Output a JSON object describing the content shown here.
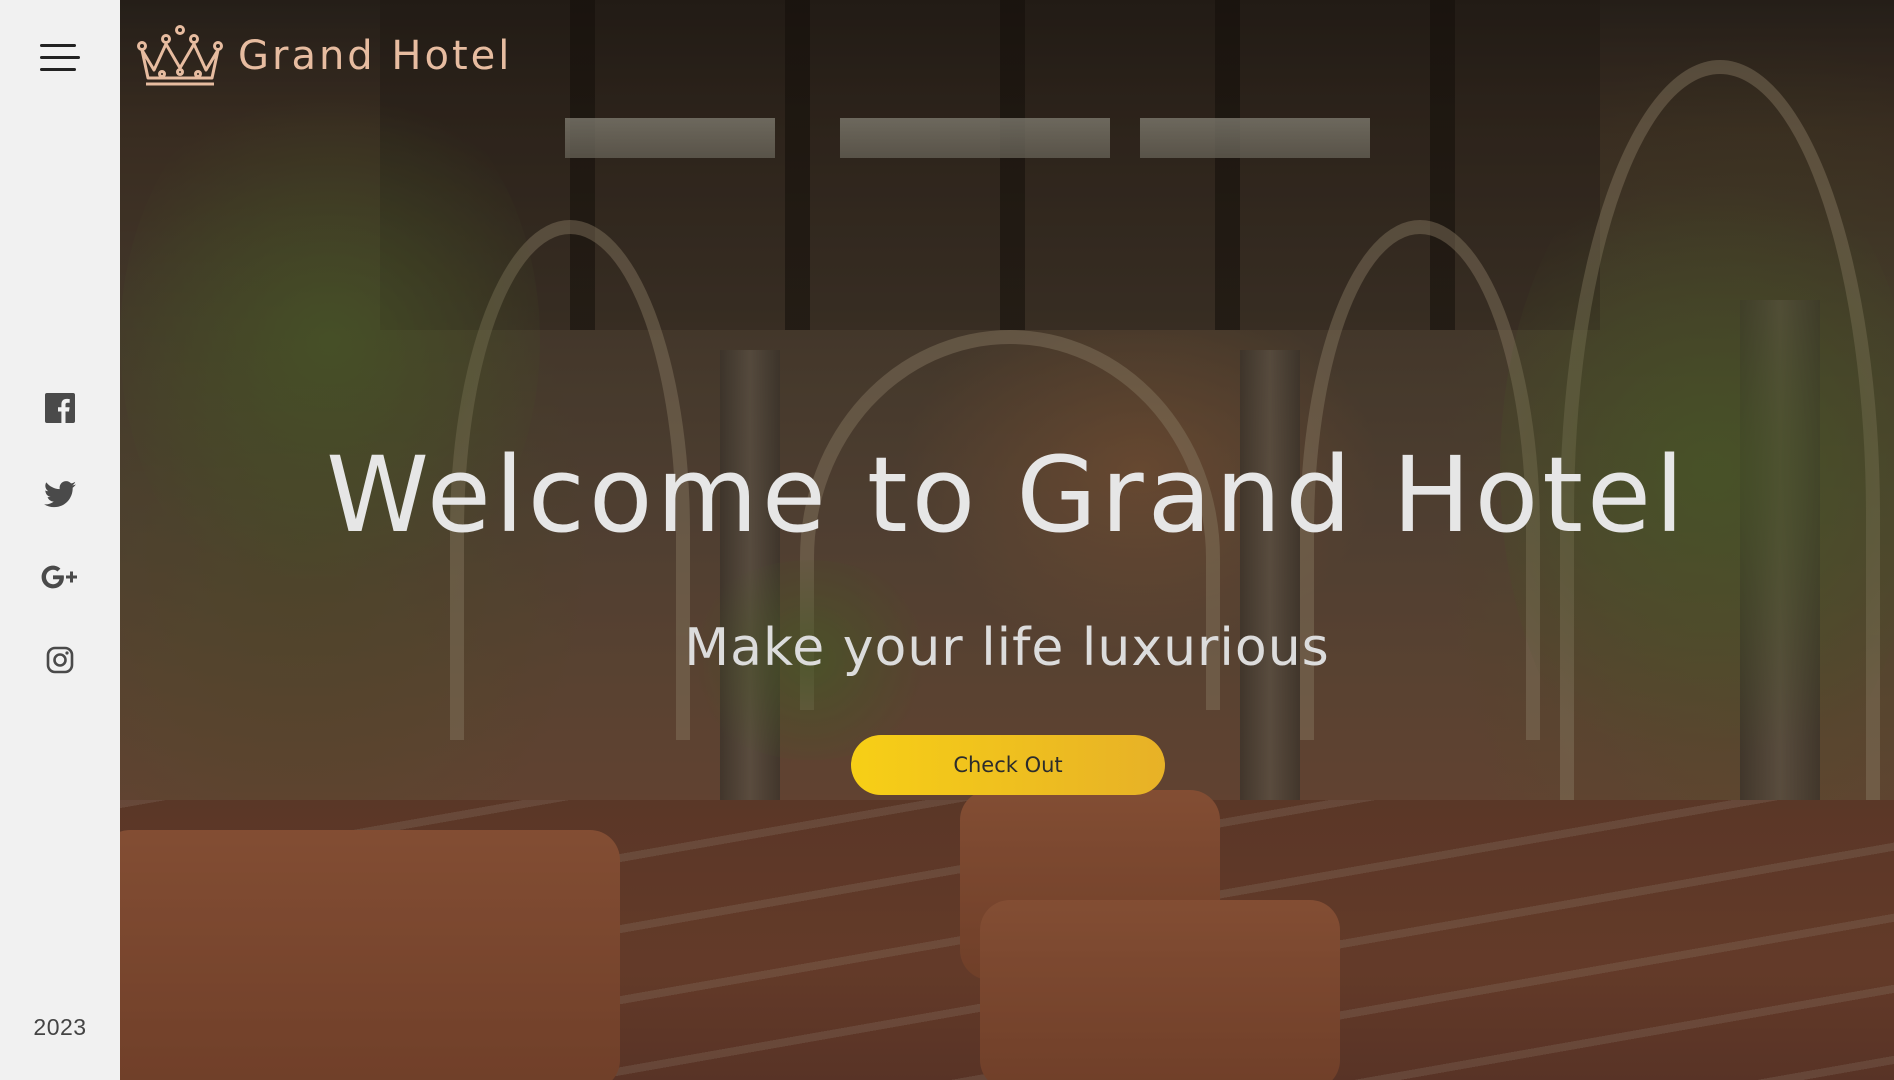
{
  "brand": {
    "name": "Grand Hotel"
  },
  "hero": {
    "title": "Welcome to Grand Hotel",
    "subtitle": "Make your life luxurious",
    "cta_label": "Check Out"
  },
  "sidebar": {
    "social": [
      "facebook-icon",
      "twitter-icon",
      "google-plus-icon",
      "instagram-icon"
    ],
    "year": "2023"
  },
  "colors": {
    "sidebar_bg": "#f1f1f1",
    "brand_text": "#e7bca0",
    "cta_gradient_start": "#f7cf16",
    "cta_gradient_end": "#e7b127"
  }
}
